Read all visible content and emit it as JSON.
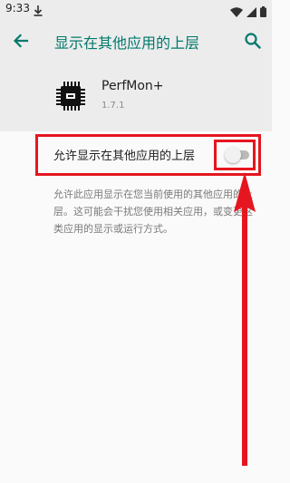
{
  "status_bar": {
    "time": "9:33"
  },
  "header": {
    "title": "显示在其他应用的上层"
  },
  "app": {
    "name": "PerfMon+",
    "version": "1.7.1"
  },
  "setting": {
    "label": "允许显示在其他应用的上层",
    "enabled": false
  },
  "description": {
    "text": "允许此应用显示在您当前使用的其他应用的上层。这可能会干扰您使用相关应用，或变更这类应用的显示或运行方式。"
  },
  "colors": {
    "accent": "#00796b",
    "annotation": "#e5161f",
    "toggle_track": "#b9b9b9"
  },
  "icons": {
    "back": "arrow-back-icon",
    "search": "search-icon",
    "app": "chip-icon",
    "download": "download-icon",
    "wifi": "wifi-icon",
    "signal": "signal-icon",
    "battery": "battery-icon"
  }
}
